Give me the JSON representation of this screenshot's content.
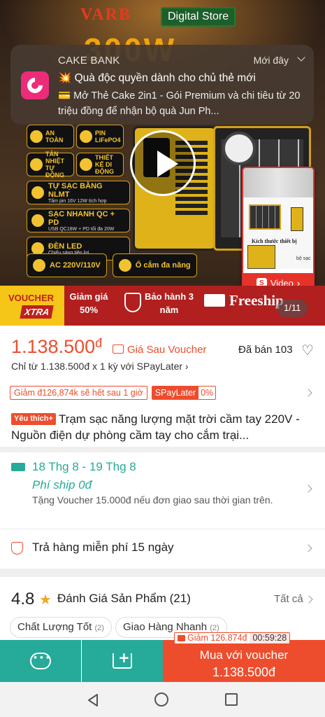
{
  "hero": {
    "brand": "VARB",
    "store": "Digital Store",
    "headline": "300W",
    "features": [
      {
        "label": "AN TOÀN"
      },
      {
        "label": "PIN LiFePO4"
      },
      {
        "label": "TẢN NHIỆT TỰ ĐỘNG"
      },
      {
        "label": "THIẾT KẾ DI ĐỘNG"
      }
    ],
    "wide_features": [
      {
        "label": "TỰ SẠC BẰNG NLMT",
        "sub": "Tấm pin 16V 12W tích hợp"
      },
      {
        "label": "SẠC NHANH QC + PD",
        "sub": "USB QC18W + PD tối đa 20W"
      },
      {
        "label": "ĐÈN LED",
        "sub": "Chiếu sáng tiện lợi"
      }
    ],
    "ac_label": "AC 220V/110V",
    "socket_label": "Ổ cắm đa năng",
    "thumb_caption": "Kích thước thiết bị",
    "thumb_caption2": "bộ sạc",
    "video_label": "Video",
    "video_icon": "S"
  },
  "notification": {
    "app": "CAKE BANK",
    "time": "Mới đây",
    "title": "💥 Quà độc quyền dành cho chủ thẻ mới",
    "body": "💳 Mở Thẻ Cake 2in1 - Gói Premium và chi tiêu từ 20 triệu đồng để nhận bộ quà Jun Ph..."
  },
  "promo": {
    "voucher_top": "VOUCHER",
    "voucher_bottom": "XTRA",
    "discount": "Giảm giá 50%",
    "warranty": "Bảo hành 3 năm",
    "freeship": "Freeship",
    "counter": "1/11"
  },
  "price": {
    "amount": "1.138.500",
    "currency": "đ",
    "after_voucher": "Giá Sau Voucher",
    "sold": "Đã bán 103",
    "installment": "Chỉ từ 1.138.500đ x 1 kỳ với SPayLater ›"
  },
  "tags": {
    "discount_tag": "Giảm đ126,874k sẽ hết sau 1 giờ",
    "spay_a": "SPayLater",
    "spay_b": "0%"
  },
  "product": {
    "badge": "Yêu thích+",
    "title": "Trạm sạc năng lượng mặt trời cầm tay 220V - Nguồn điện dự phòng cầm tay cho cắm trại..."
  },
  "shipping": {
    "date": "18 Thg 8 - 19 Thg 8",
    "fee": "Phí ship 0đ",
    "note": "Tặng Voucher 15.000đ nếu đơn giao sau thời gian trên."
  },
  "returns": {
    "text": "Trả hàng miễn phí 15 ngày"
  },
  "rating": {
    "score": "4.8",
    "title": "Đánh Giá Sản Phẩm (21)",
    "see_all": "Tất cả",
    "chips": [
      {
        "label": "Chất Lượng Tốt",
        "count": "(2)"
      },
      {
        "label": "Giao Hàng Nhanh",
        "count": "(2)"
      }
    ]
  },
  "bottom_bar": {
    "countdown_discount": "Giảm 126.874đ",
    "countdown_time": "00:59:28",
    "buy_label": "Mua với voucher",
    "buy_price": "1.138.500đ"
  },
  "colors": {
    "accent": "#ee4d2d",
    "teal": "#26aa99"
  }
}
